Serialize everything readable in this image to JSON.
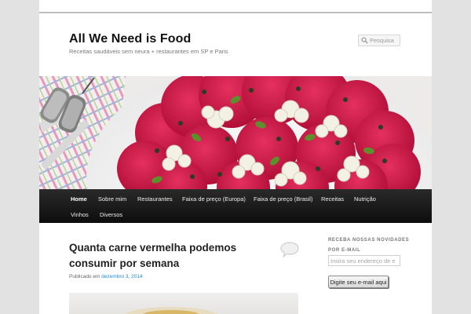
{
  "site": {
    "title": "All We Need is Food",
    "description": "Receitas saudáveis sem neura + restaurantes em SP e Paris"
  },
  "search": {
    "placeholder": "Pesquisa"
  },
  "nav": {
    "items": [
      {
        "label": "Home",
        "active": true
      },
      {
        "label": "Sobre mim"
      },
      {
        "label": "Restaurantes"
      },
      {
        "label": "Faixa de preço (Europa)"
      },
      {
        "label": "Faixa de preço (Brasil)"
      },
      {
        "label": "Receitas"
      },
      {
        "label": "Nutrição"
      },
      {
        "label": "Vinhos"
      },
      {
        "label": "Diversos"
      }
    ]
  },
  "post": {
    "title": "Quanta carne vermelha podemos consumir por semana",
    "meta_prefix": "Publicado em",
    "date": "dezembro 3, 2014"
  },
  "sidebar": {
    "widget_title": "Receba nossas novidades por e-mail",
    "email_placeholder": "Insira seu endereço de e",
    "button_label": "Digite seu e-mail aqui"
  },
  "icons": {
    "search": "magnifier-icon",
    "comment": "comment-bubble-icon"
  },
  "colors": {
    "nav_background": "#111111",
    "date_link": "#1b8be0",
    "beet_red": "#c4163b"
  }
}
